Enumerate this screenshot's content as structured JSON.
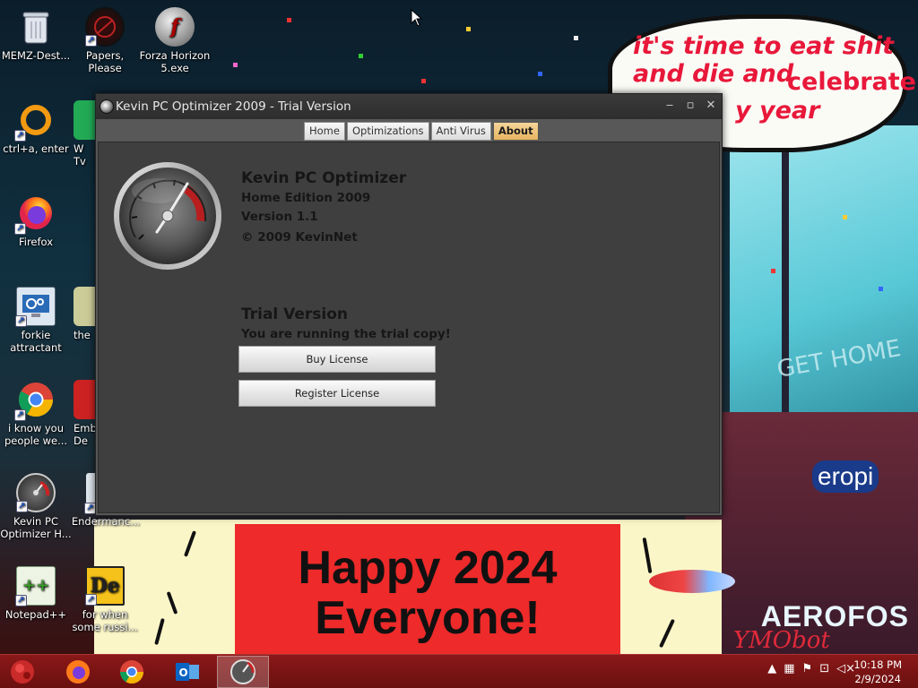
{
  "wallpaper": {
    "bubble_line1": "it's time to eat shit",
    "bubble_line2": "and die and",
    "bubble_line2b": "celebrate",
    "bubble_line3": "y year",
    "sign_text": "GET HOME",
    "banner_text": "Happy 2024 Everyone!",
    "signature": "YMObot",
    "sticker_text": "AEROFOS",
    "sticker2_text": "eropi"
  },
  "desktop_icons": [
    {
      "label": "MEMZ-Dest...",
      "icon": "recycle-bin-icon"
    },
    {
      "label": "Papers, Please",
      "icon": "papers-please-icon"
    },
    {
      "label": "Forza Horizon 5.exe",
      "icon": "flash-icon"
    },
    {
      "label": "ctrl+a, enter",
      "icon": "orange-ring-icon"
    },
    {
      "label": "W Tv",
      "icon": "partial-icon"
    },
    {
      "label": "Firefox",
      "icon": "firefox-icon"
    },
    {
      "label": "forkie attractant",
      "icon": "system-settings-icon"
    },
    {
      "label": "the",
      "icon": "partial-icon"
    },
    {
      "label": "i know you people we...",
      "icon": "chrome-icon"
    },
    {
      "label": "Emb De",
      "icon": "partial-icon"
    },
    {
      "label": "Kevin PC Optimizer H...",
      "icon": "gauge-icon"
    },
    {
      "label": "Endermanc...",
      "icon": "partial-icon"
    },
    {
      "label": "Notepad++",
      "icon": "notepad-plus-plus-icon"
    },
    {
      "label": "for when some russi...",
      "icon": "de-icon"
    }
  ],
  "window": {
    "title": "Kevin PC Optimizer 2009 - Trial Version",
    "tabs": [
      "Home",
      "Optimizations",
      "Anti Virus",
      "About"
    ],
    "active_tab": "About",
    "about": {
      "product": "Kevin PC Optimizer",
      "edition": "Home Edition 2009",
      "version": "Version 1.1",
      "copyright": "© 2009 KevinNet",
      "trial_heading": "Trial Version",
      "trial_message": "You are running the trial copy!",
      "buy_button": "Buy License",
      "register_button": "Register License"
    }
  },
  "taskbar": {
    "items": [
      "start-orb-icon",
      "firefox-icon",
      "chrome-icon",
      "outlook-icon",
      "gauge-icon"
    ],
    "active_item": "gauge-icon",
    "clock_time": "10:18 PM",
    "clock_date": "2/9/2024"
  },
  "colors": {
    "taskbar": "#7a1414",
    "window_bg": "#3f3f3f",
    "active_tab": "#e8b460"
  }
}
